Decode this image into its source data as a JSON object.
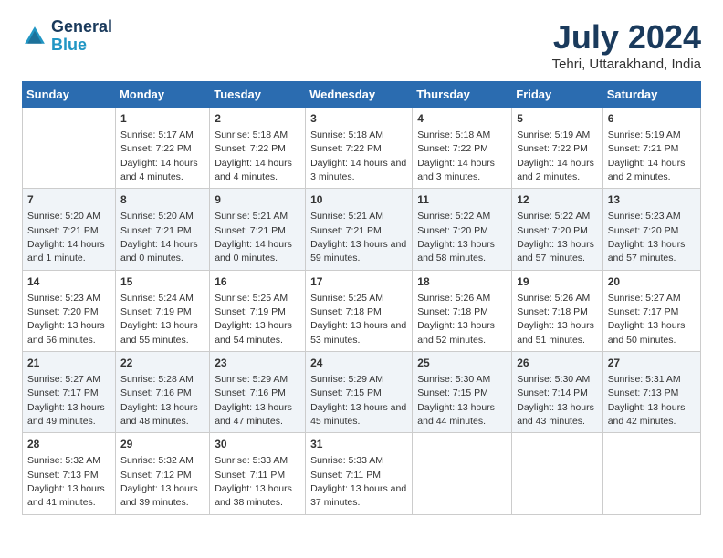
{
  "header": {
    "logo_line1": "General",
    "logo_line2": "Blue",
    "main_title": "July 2024",
    "subtitle": "Tehri, Uttarakhand, India"
  },
  "days_header": [
    "Sunday",
    "Monday",
    "Tuesday",
    "Wednesday",
    "Thursday",
    "Friday",
    "Saturday"
  ],
  "weeks": [
    [
      {
        "day": "",
        "empty": true
      },
      {
        "day": "1",
        "sunrise": "5:17 AM",
        "sunset": "7:22 PM",
        "daylight": "14 hours and 4 minutes."
      },
      {
        "day": "2",
        "sunrise": "5:18 AM",
        "sunset": "7:22 PM",
        "daylight": "14 hours and 4 minutes."
      },
      {
        "day": "3",
        "sunrise": "5:18 AM",
        "sunset": "7:22 PM",
        "daylight": "14 hours and 3 minutes."
      },
      {
        "day": "4",
        "sunrise": "5:18 AM",
        "sunset": "7:22 PM",
        "daylight": "14 hours and 3 minutes."
      },
      {
        "day": "5",
        "sunrise": "5:19 AM",
        "sunset": "7:22 PM",
        "daylight": "14 hours and 2 minutes."
      },
      {
        "day": "6",
        "sunrise": "5:19 AM",
        "sunset": "7:21 PM",
        "daylight": "14 hours and 2 minutes."
      }
    ],
    [
      {
        "day": "7",
        "sunrise": "5:20 AM",
        "sunset": "7:21 PM",
        "daylight": "14 hours and 1 minute."
      },
      {
        "day": "8",
        "sunrise": "5:20 AM",
        "sunset": "7:21 PM",
        "daylight": "14 hours and 0 minutes."
      },
      {
        "day": "9",
        "sunrise": "5:21 AM",
        "sunset": "7:21 PM",
        "daylight": "14 hours and 0 minutes."
      },
      {
        "day": "10",
        "sunrise": "5:21 AM",
        "sunset": "7:21 PM",
        "daylight": "13 hours and 59 minutes."
      },
      {
        "day": "11",
        "sunrise": "5:22 AM",
        "sunset": "7:20 PM",
        "daylight": "13 hours and 58 minutes."
      },
      {
        "day": "12",
        "sunrise": "5:22 AM",
        "sunset": "7:20 PM",
        "daylight": "13 hours and 57 minutes."
      },
      {
        "day": "13",
        "sunrise": "5:23 AM",
        "sunset": "7:20 PM",
        "daylight": "13 hours and 57 minutes."
      }
    ],
    [
      {
        "day": "14",
        "sunrise": "5:23 AM",
        "sunset": "7:20 PM",
        "daylight": "13 hours and 56 minutes."
      },
      {
        "day": "15",
        "sunrise": "5:24 AM",
        "sunset": "7:19 PM",
        "daylight": "13 hours and 55 minutes."
      },
      {
        "day": "16",
        "sunrise": "5:25 AM",
        "sunset": "7:19 PM",
        "daylight": "13 hours and 54 minutes."
      },
      {
        "day": "17",
        "sunrise": "5:25 AM",
        "sunset": "7:18 PM",
        "daylight": "13 hours and 53 minutes."
      },
      {
        "day": "18",
        "sunrise": "5:26 AM",
        "sunset": "7:18 PM",
        "daylight": "13 hours and 52 minutes."
      },
      {
        "day": "19",
        "sunrise": "5:26 AM",
        "sunset": "7:18 PM",
        "daylight": "13 hours and 51 minutes."
      },
      {
        "day": "20",
        "sunrise": "5:27 AM",
        "sunset": "7:17 PM",
        "daylight": "13 hours and 50 minutes."
      }
    ],
    [
      {
        "day": "21",
        "sunrise": "5:27 AM",
        "sunset": "7:17 PM",
        "daylight": "13 hours and 49 minutes."
      },
      {
        "day": "22",
        "sunrise": "5:28 AM",
        "sunset": "7:16 PM",
        "daylight": "13 hours and 48 minutes."
      },
      {
        "day": "23",
        "sunrise": "5:29 AM",
        "sunset": "7:16 PM",
        "daylight": "13 hours and 47 minutes."
      },
      {
        "day": "24",
        "sunrise": "5:29 AM",
        "sunset": "7:15 PM",
        "daylight": "13 hours and 45 minutes."
      },
      {
        "day": "25",
        "sunrise": "5:30 AM",
        "sunset": "7:15 PM",
        "daylight": "13 hours and 44 minutes."
      },
      {
        "day": "26",
        "sunrise": "5:30 AM",
        "sunset": "7:14 PM",
        "daylight": "13 hours and 43 minutes."
      },
      {
        "day": "27",
        "sunrise": "5:31 AM",
        "sunset": "7:13 PM",
        "daylight": "13 hours and 42 minutes."
      }
    ],
    [
      {
        "day": "28",
        "sunrise": "5:32 AM",
        "sunset": "7:13 PM",
        "daylight": "13 hours and 41 minutes."
      },
      {
        "day": "29",
        "sunrise": "5:32 AM",
        "sunset": "7:12 PM",
        "daylight": "13 hours and 39 minutes."
      },
      {
        "day": "30",
        "sunrise": "5:33 AM",
        "sunset": "7:11 PM",
        "daylight": "13 hours and 38 minutes."
      },
      {
        "day": "31",
        "sunrise": "5:33 AM",
        "sunset": "7:11 PM",
        "daylight": "13 hours and 37 minutes."
      },
      {
        "day": "",
        "empty": true
      },
      {
        "day": "",
        "empty": true
      },
      {
        "day": "",
        "empty": true
      }
    ]
  ]
}
